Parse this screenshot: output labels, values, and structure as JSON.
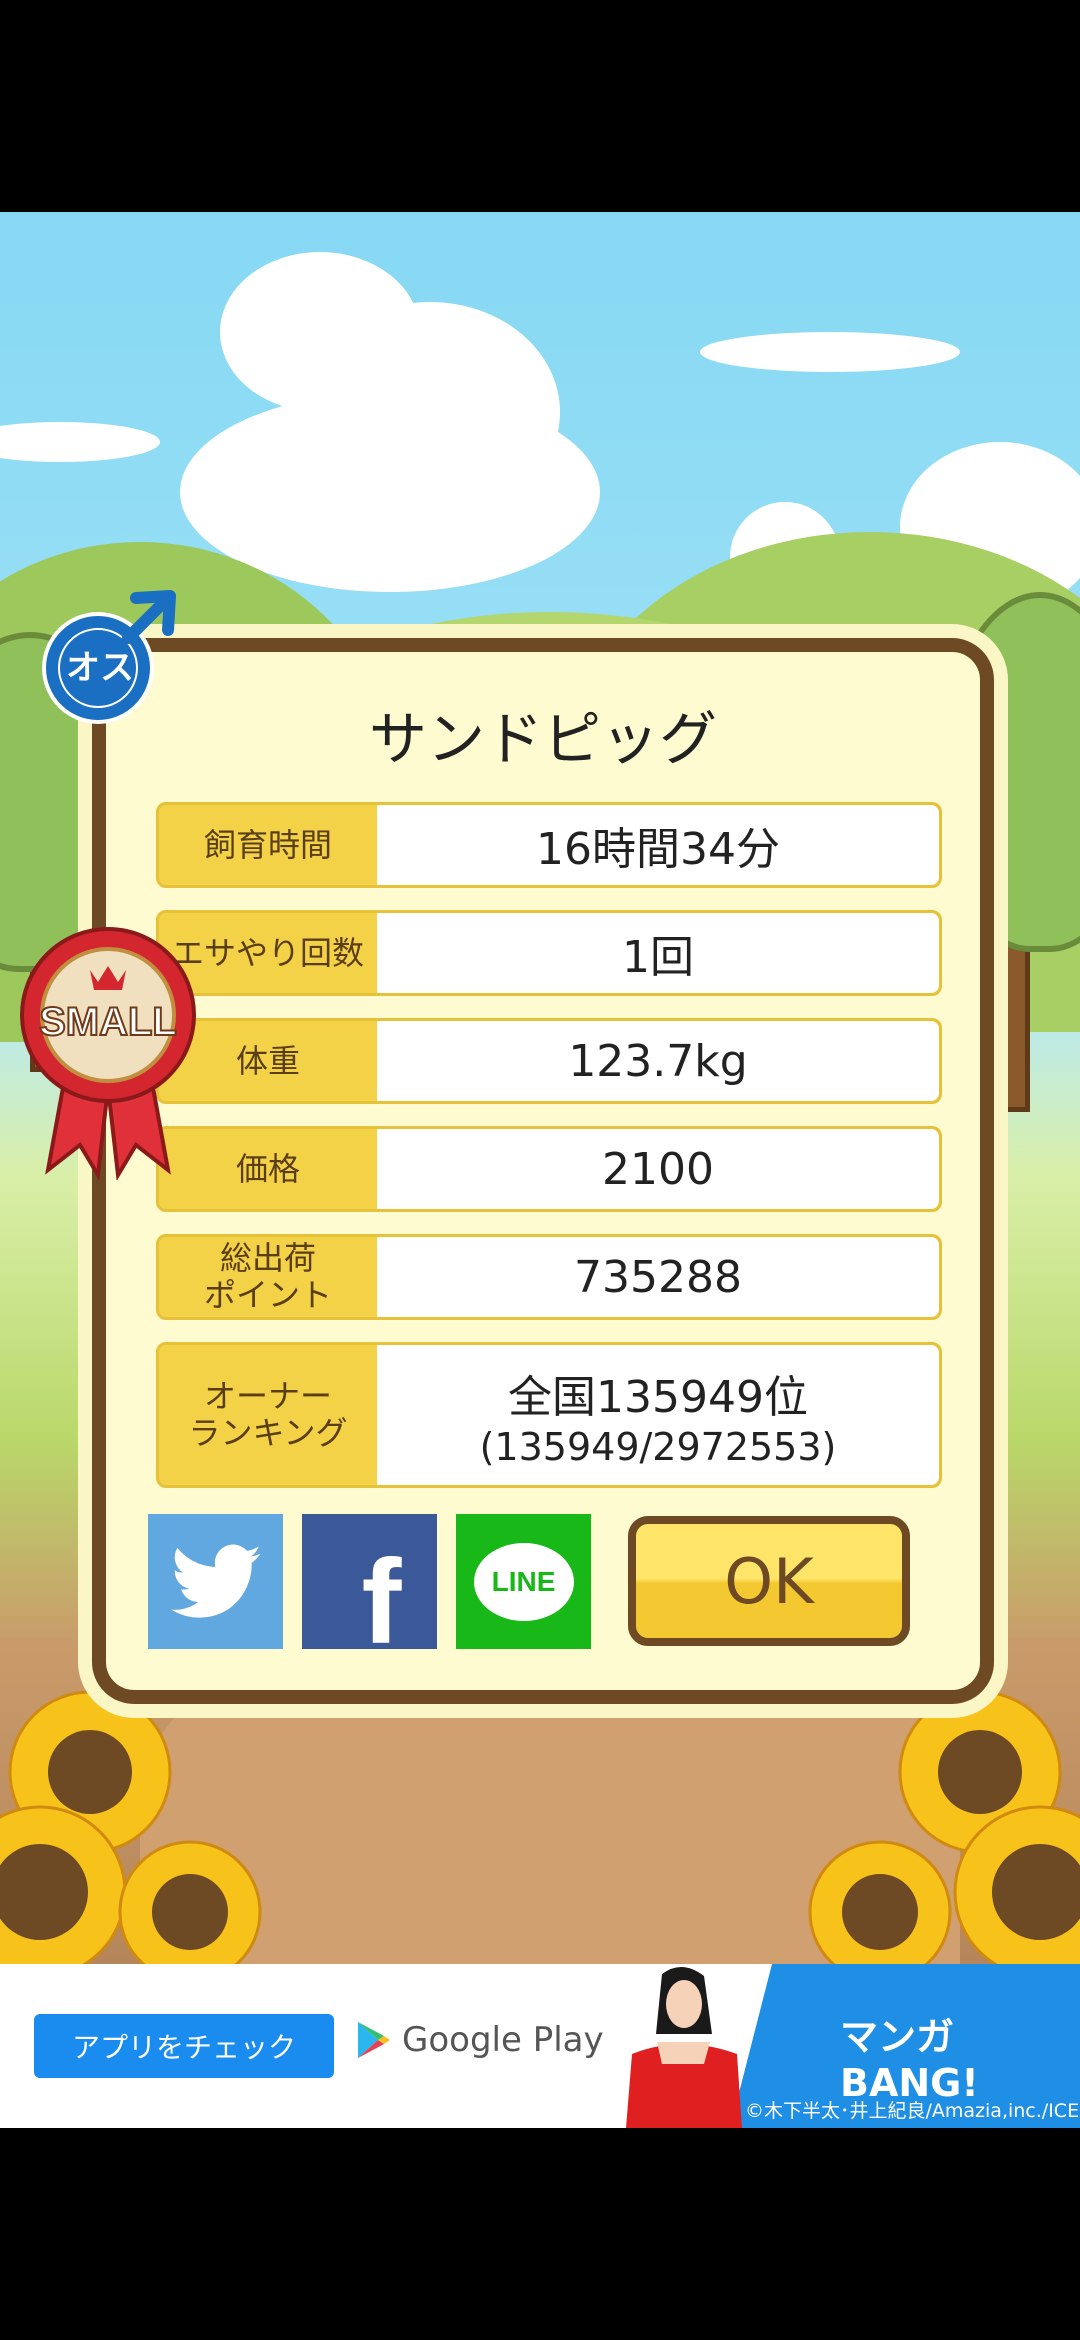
{
  "pig": {
    "name": "サンドピッグ",
    "gender_label": "オス",
    "size_badge": "SMALL"
  },
  "stats": [
    {
      "label": "飼育時間",
      "value": "16時間34分"
    },
    {
      "label": "エサやり回数",
      "value": "1回"
    },
    {
      "label": "体重",
      "value": "123.7kg"
    },
    {
      "label": "価格",
      "value": "2100"
    },
    {
      "label": "総出荷\nポイント",
      "value": "735288"
    },
    {
      "label": "オーナー\nランキング",
      "value": "全国135949位",
      "value2": "(135949/2972553)"
    }
  ],
  "buttons": {
    "ok": "OK",
    "line": "LINE",
    "facebook": "f"
  },
  "ad": {
    "cta": "アプリをチェック",
    "store": "Google Play",
    "brand": "マンガBANG!",
    "credit": "©木下半太･井上紀良/Amazia,inc./ICE"
  },
  "colors": {
    "twitter": "#62a8e0",
    "facebook": "#3b5998",
    "line": "#18b818",
    "ok": "#f4c830"
  }
}
